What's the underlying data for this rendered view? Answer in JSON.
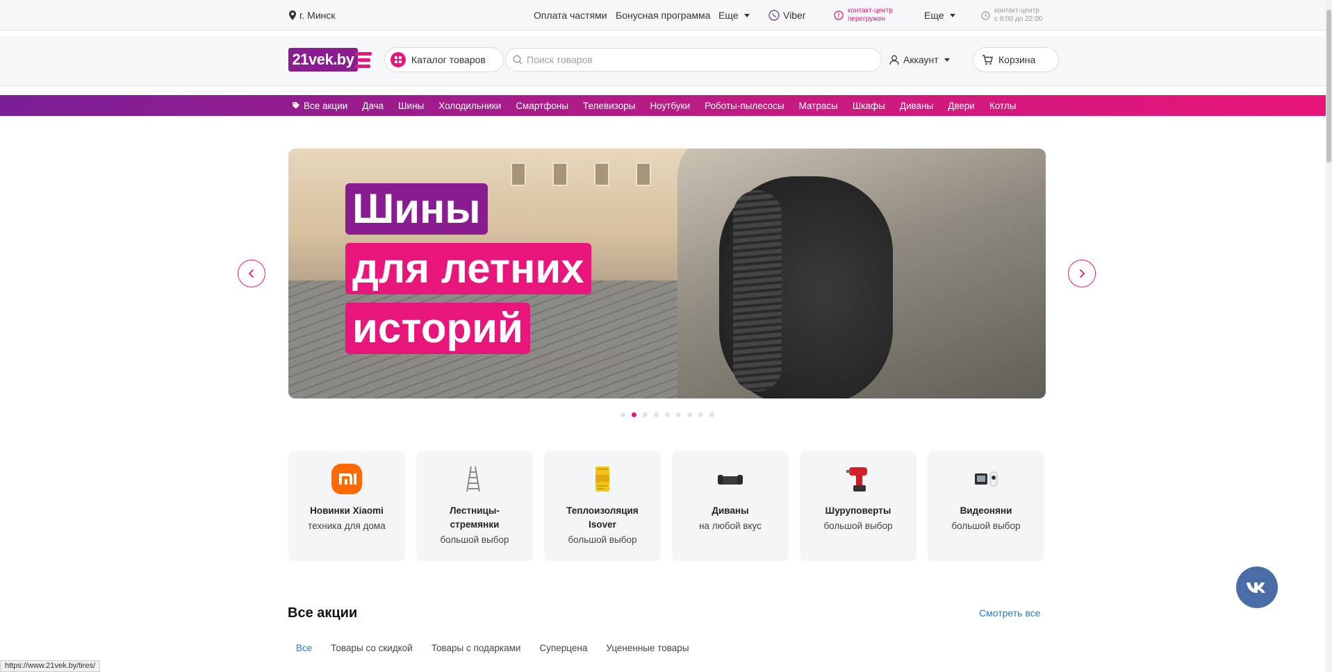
{
  "topbar": {
    "city": "г. Минск",
    "payment": "Оплата частями",
    "bonus": "Бонусная программа",
    "more1": "Еще",
    "viber": "Viber",
    "contact_line1": "контакт-центр",
    "contact_line2": "перегружен",
    "more2": "Еще",
    "hours_line1": "контакт-центр",
    "hours_line2": "с 8:00 до 22:00"
  },
  "header": {
    "logo_text": "21vek.by",
    "catalog_label": "Каталог товаров",
    "search_placeholder": "Поиск товаров",
    "account_label": "Аккаунт",
    "cart_label": "Корзина"
  },
  "nav": {
    "items": [
      "Все акции",
      "Дача",
      "Шины",
      "Холодильники",
      "Смартфоны",
      "Телевизоры",
      "Ноутбуки",
      "Роботы-пылесосы",
      "Матрасы",
      "Шкафы",
      "Диваны",
      "Двери",
      "Котлы"
    ]
  },
  "hero": {
    "line1": "Шины",
    "line2": "для летних",
    "line3": "историй",
    "slide_count": 9,
    "active_slide": 1
  },
  "tiles": [
    {
      "title": "Новинки Xiaomi",
      "subtitle": "техника для дома",
      "icon": "xiaomi-logo-icon"
    },
    {
      "title": "Лестницы-стремянки",
      "subtitle": "большой выбор",
      "icon": "ladder-icon"
    },
    {
      "title": "Теплоизоляция Isover",
      "subtitle": "большой выбор",
      "icon": "insulation-icon"
    },
    {
      "title": "Диваны",
      "subtitle": "на любой вкус",
      "icon": "sofa-icon"
    },
    {
      "title": "Шуруповерты",
      "subtitle": "большой выбор",
      "icon": "drill-icon"
    },
    {
      "title": "Видеоняни",
      "subtitle": "большой выбор",
      "icon": "baby-monitor-icon"
    }
  ],
  "promotions": {
    "title": "Все акции",
    "see_all": "Смотреть все",
    "tabs": [
      "Все",
      "Товары со скидкой",
      "Товары с подарками",
      "Суперцена",
      "Уцененные товары"
    ],
    "active_tab": 0
  },
  "statusbar": {
    "url": "https://www.21vek.by/tires/"
  },
  "colors": {
    "brand_purple": "#8a1c92",
    "brand_pink": "#e8157a",
    "link_blue": "#1a7fc9"
  }
}
